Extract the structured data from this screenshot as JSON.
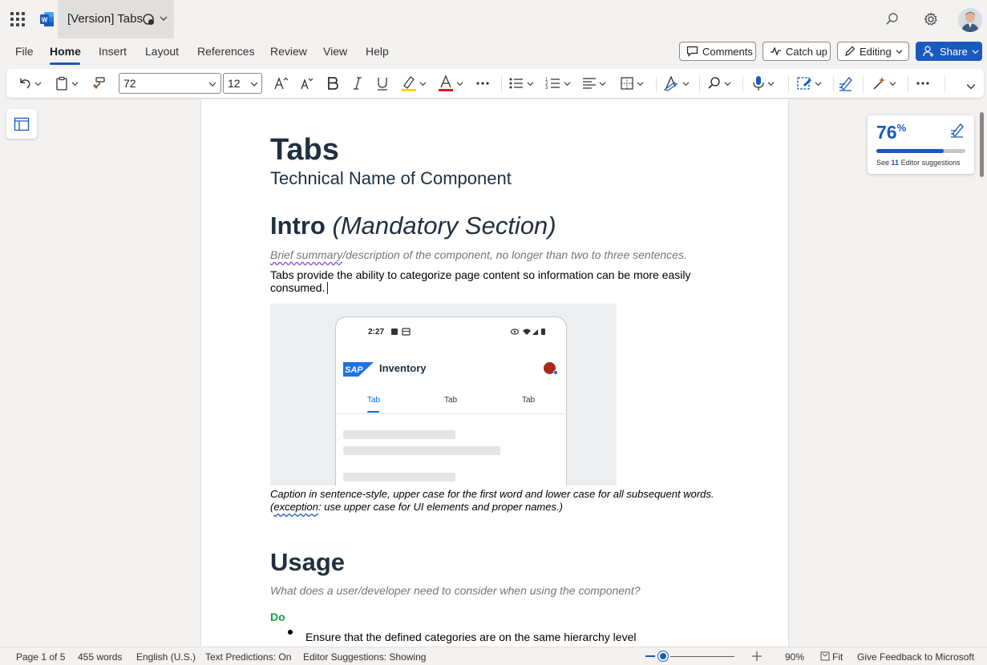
{
  "titlebar": {
    "doc_title": "[Version] Tabs",
    "icons": [
      "app-launcher-icon",
      "word-logo-icon",
      "sync-icon",
      "chevron-down-icon",
      "search-icon",
      "gear-icon",
      "avatar"
    ]
  },
  "menu": {
    "tabs": [
      "File",
      "Home",
      "Insert",
      "Layout",
      "References",
      "Review",
      "View",
      "Help"
    ],
    "active": "Home",
    "comments": "Comments",
    "catch_up": "Catch up",
    "editing": "Editing",
    "share": "Share"
  },
  "ribbon": {
    "font_name": "72",
    "font_size": "12",
    "highlight_color": "#ffd700",
    "font_color": "#e81123"
  },
  "document": {
    "title": "Tabs",
    "subtitle": "Technical Name of Component",
    "intro_heading": "Intro",
    "intro_heading_suffix": "(Mandatory Section)",
    "brief_word": "Brief summary",
    "brief_rest": "/description of the component, no longer than two to three sentences.",
    "body": "Tabs provide the ability to categorize page content so information can be more easily consumed.",
    "caption_line1": "Caption in sentence-style, upper case for the first word and lower case for all subsequent words.",
    "caption_open": "(",
    "caption_exception": "exception",
    "caption_line2": ": use upper case for UI elements and proper names.)",
    "usage_heading": "Usage",
    "usage_question": "What does a user/developer need to consider when using the component?",
    "do_label": "Do",
    "do_bullet_1": "Ensure that the defined categories are on the same hierarchy level"
  },
  "mockup": {
    "time": "2:27",
    "brand": "SAP",
    "app_title": "Inventory",
    "tabs": [
      "Tab",
      "Tab",
      "Tab"
    ],
    "selected_tab": 0
  },
  "editor_card": {
    "score": "76",
    "score_suffix": "%",
    "score_fraction": 0.76,
    "suggestions_prefix": "See",
    "suggestions_count": "11",
    "suggestions_suffix": "Editor suggestions"
  },
  "statusbar": {
    "page": "Page 1 of 5",
    "words": "455 words",
    "language": "English (U.S.)",
    "text_predictions": "Text Predictions: On",
    "editor_suggestions": "Editor Suggestions: Showing",
    "zoom": "90%",
    "fit": "Fit",
    "feedback": "Give Feedback to Microsoft"
  }
}
